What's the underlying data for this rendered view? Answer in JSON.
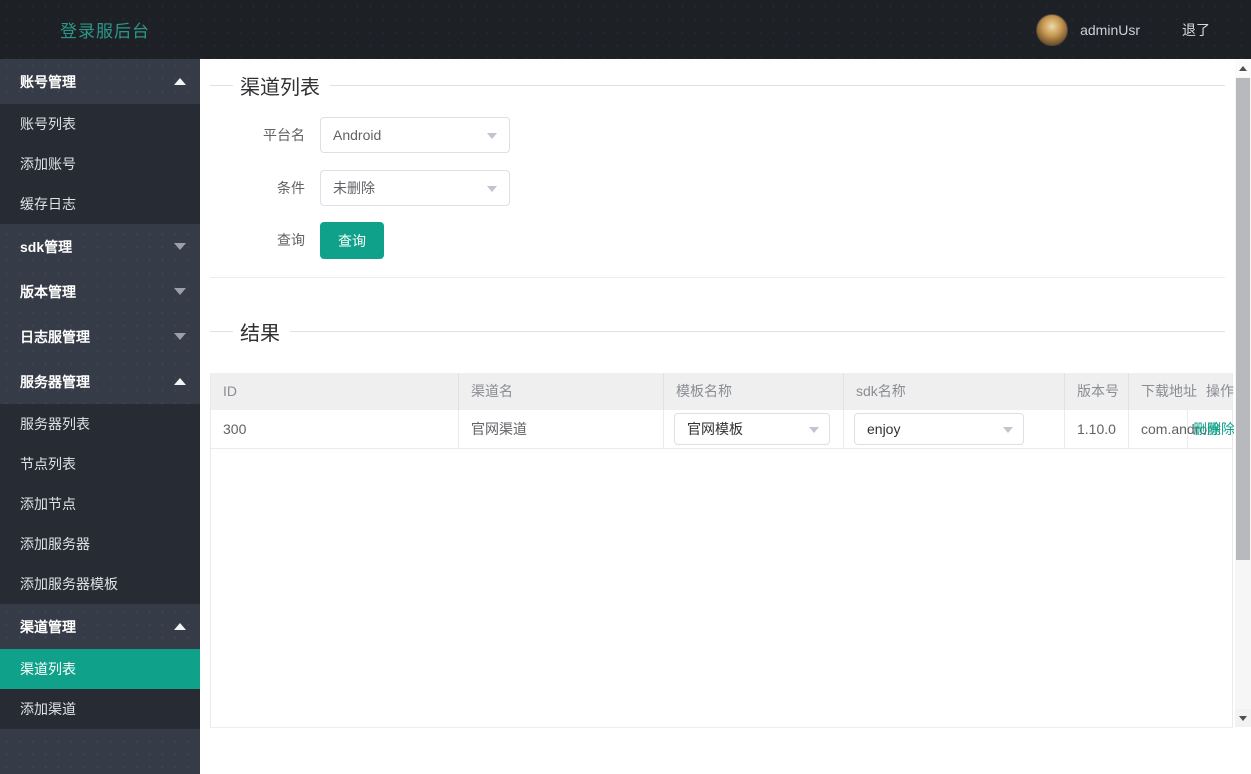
{
  "header": {
    "brand": "登录服后台",
    "username": "adminUsr",
    "logout_label": "退了"
  },
  "sidebar": {
    "groups": [
      {
        "label": "账号管理",
        "state": "expanded",
        "children": [
          "账号列表",
          "添加账号",
          "缓存日志"
        ]
      },
      {
        "label": "sdk管理",
        "state": "collapsed",
        "children": []
      },
      {
        "label": "版本管理",
        "state": "collapsed",
        "children": []
      },
      {
        "label": "日志服管理",
        "state": "collapsed",
        "children": []
      },
      {
        "label": "服务器管理",
        "state": "expanded",
        "children": [
          "服务器列表",
          "节点列表",
          "添加节点",
          "添加服务器",
          "添加服务器模板"
        ]
      },
      {
        "label": "渠道管理",
        "state": "expanded",
        "children": [
          "渠道列表",
          "添加渠道"
        ],
        "active_child": "渠道列表"
      }
    ]
  },
  "main": {
    "section_title": "渠道列表",
    "form": {
      "platform_label": "平台名",
      "platform_value": "Android",
      "condition_label": "条件",
      "condition_value": "未删除",
      "query_label": "查询",
      "query_button": "查询"
    },
    "result_title": "结果",
    "table": {
      "columns": [
        "ID",
        "渠道名",
        "模板名称",
        "sdk名称",
        "版本号",
        "下载地址",
        "操作"
      ],
      "rows": [
        {
          "id": "300",
          "channel_name": "官网渠道",
          "template_value": "官网模板",
          "sdk_value": "enjoy",
          "version": "1.10.0",
          "download": "com.androi",
          "action": "删除"
        }
      ]
    }
  },
  "colors": {
    "accent_teal": "#0fa18a",
    "brand_text": "#2d9688",
    "topbar_bg": "#1d2126",
    "sidebar_bg": "#363c47",
    "submenu_bg": "#272b33",
    "table_header_bg": "#efefef"
  }
}
